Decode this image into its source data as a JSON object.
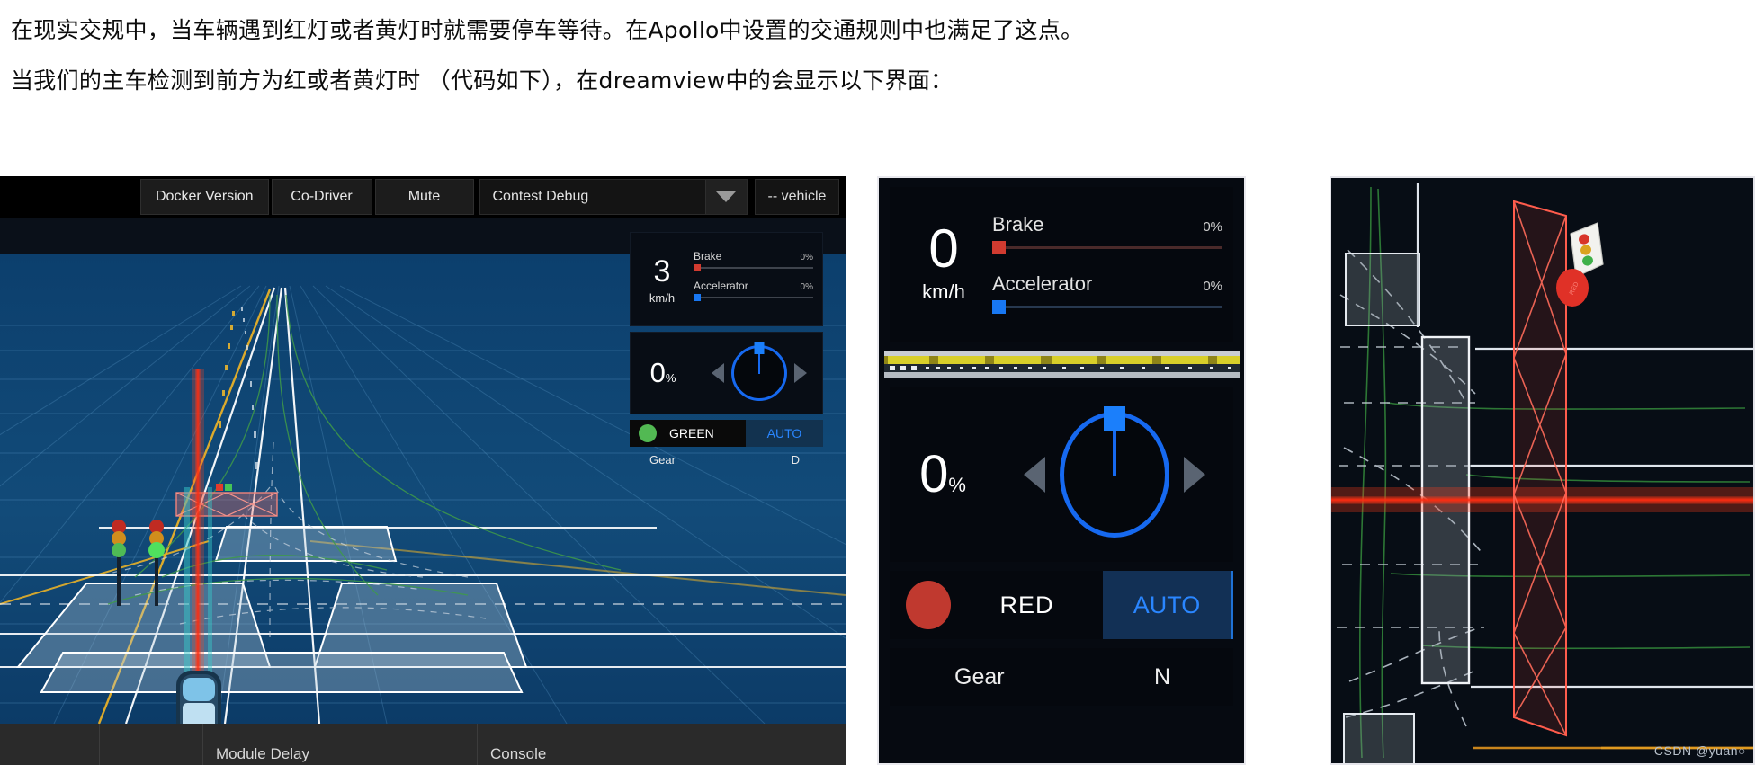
{
  "article": {
    "line1": "在现实交规中，当车辆遇到红灯或者黄灯时就需要停车等待。在Apollo中设置的交通规则中也满足了这点。",
    "line2": "当我们的主车检测到前方为红或者黄灯时 （代码如下），在dreamview中的会显示以下界面："
  },
  "panel1": {
    "toolbar": {
      "docker_version": "Docker Version",
      "co_driver": "Co-Driver",
      "mute": "Mute",
      "mode_selected": "Contest Debug",
      "vehicle": "-- vehicle"
    },
    "hud": {
      "speed_value": "3",
      "speed_unit": "km/h",
      "brake_label": "Brake",
      "brake_pct": "0%",
      "accelerator_label": "Accelerator",
      "accelerator_pct": "0%",
      "steering_value": "0",
      "steering_unit": "%",
      "signal_text": "GREEN",
      "signal_color": "#52b953",
      "drive_mode": "AUTO",
      "gear_label": "Gear",
      "gear_value": "D"
    },
    "bottom": {
      "module_delay": "Module Delay",
      "console": "Console"
    }
  },
  "panel2": {
    "speed_value": "0",
    "speed_unit": "km/h",
    "brake_label": "Brake",
    "brake_pct": "0%",
    "accelerator_label": "Accelerator",
    "accelerator_pct": "0%",
    "steering_value": "0",
    "steering_unit": "%",
    "signal_text": "RED",
    "signal_color": "#c0392f",
    "drive_mode": "AUTO",
    "gear_label": "Gear",
    "gear_value": "N"
  },
  "panel3": {
    "watermark": "CSDN @yuan○"
  },
  "colors": {
    "accent_blue": "#1669f0",
    "brake_red": "#d13b30",
    "accel_blue": "#1877f2",
    "stop_line_red": "#ff2b10",
    "scene_blue": "#0f4673",
    "panel_bg": "#05080e"
  }
}
